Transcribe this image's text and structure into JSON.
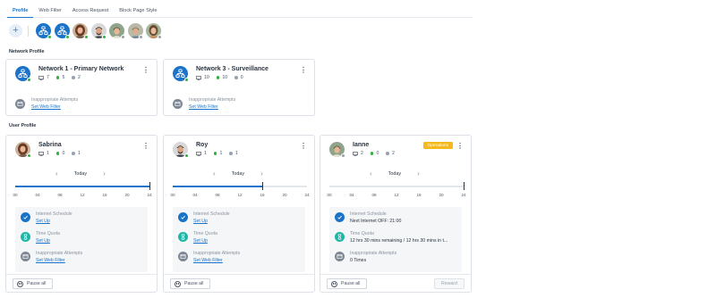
{
  "tabs": [
    {
      "label": "Profile"
    },
    {
      "label": "Web Filter"
    },
    {
      "label": "Access Request"
    },
    {
      "label": "Block Page Style"
    }
  ],
  "avatar_strip": {
    "add_label": "+",
    "items": [
      {
        "kind": "network",
        "status": "online"
      },
      {
        "kind": "network",
        "status": "online"
      },
      {
        "kind": "person",
        "name": "Sabrina",
        "status": "online"
      },
      {
        "kind": "person",
        "name": "Roy",
        "status": "online"
      },
      {
        "kind": "person",
        "name": "Ianne",
        "status": "offline"
      },
      {
        "kind": "person",
        "status": "offline"
      },
      {
        "kind": "person",
        "status": "offline"
      }
    ]
  },
  "network_section": {
    "title": "Network Profile",
    "cards": [
      {
        "name": "Network 1 - Primary Network",
        "devices": "7",
        "online": "5",
        "offline": "2",
        "footer_label": "Inappropriate Attempts",
        "footer_link": "Set Web Filter"
      },
      {
        "name": "Network 3 - Surveillance",
        "devices": "10",
        "online": "10",
        "offline": "0",
        "footer_label": "Inappropriate Attempts",
        "footer_link": "Set Web Filter"
      }
    ]
  },
  "user_section": {
    "title": "User Profile",
    "cards": [
      {
        "name": "Sabrina",
        "devices": "1",
        "online": "0",
        "offline": "1",
        "day_label": "Today",
        "ticks": [
          "00",
          "04",
          "08",
          "12",
          "16",
          "20",
          "24"
        ],
        "allowed_until_hour": 24,
        "now_hour": 24,
        "schedule_label": "Internet Schedule",
        "schedule_value": "Set Up",
        "quota_label": "Time Quota",
        "quota_value": "Set Up",
        "attempts_label": "Inappropriate Attempts",
        "attempts_value": "Set Web Filter",
        "pause_label": "Pause all"
      },
      {
        "name": "Roy",
        "devices": "1",
        "online": "1",
        "offline": "1",
        "day_label": "Today",
        "ticks": [
          "00",
          "04",
          "08",
          "12",
          "16",
          "20",
          "24"
        ],
        "allowed_until_hour": 16,
        "now_hour": 16,
        "schedule_label": "Internet Schedule",
        "schedule_value": "Set Up",
        "quota_label": "Time Quota",
        "quota_value": "Set Up",
        "attempts_label": "Inappropriate Attempts",
        "attempts_value": "Set Web Filter",
        "pause_label": "Pause all"
      },
      {
        "name": "Ianne",
        "devices": "2",
        "online": "0",
        "offline": "2",
        "badge": "Operations",
        "day_label": "Today",
        "ticks": [
          "00",
          "04",
          "08",
          "12",
          "16",
          "20",
          "24"
        ],
        "allowed_until_hour": 0,
        "now_hour": 24,
        "schedule_label": "Internet Schedule",
        "schedule_value": "Next Internet OFF: 21:00",
        "quota_label": "Time Quota",
        "quota_value": "12 hrs 30 mins remaining / 12 hrs 30 mins in t...",
        "attempts_label": "Inappropriate Attempts",
        "attempts_value": "0 Times",
        "pause_label": "Pause all",
        "reward_label": "Reward"
      }
    ]
  },
  "colors": {
    "accent": "#1a73c8",
    "online": "#2fb344",
    "offline": "#9aa3ad",
    "badge": "#f5b91e",
    "quota_icon": "#1fb5a6"
  }
}
